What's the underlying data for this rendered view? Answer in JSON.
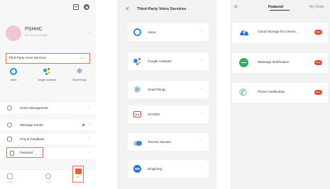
{
  "screen1": {
    "username": "PSHHC",
    "user_hint": "Set Personal Details",
    "third_party": {
      "label": "Third-Party Voice Services",
      "more": "More"
    },
    "voice_services": [
      {
        "name": "Alexa",
        "icon": "alexa-ring-icon"
      },
      {
        "name": "Google Assistant",
        "icon": "google-assistant-icon"
      },
      {
        "name": "SmartThings",
        "icon": "smartthings-star-icon"
      }
    ],
    "menu": [
      {
        "label": "Home Management",
        "icon": "home-icon"
      },
      {
        "label": "Message Center",
        "icon": "message-icon"
      },
      {
        "label": "FAQ & Feedback",
        "icon": "faq-icon"
      },
      {
        "label": "Featured",
        "icon": "featured-icon"
      }
    ],
    "tabs": [
      {
        "label": "Home",
        "icon": "home-tab-icon"
      },
      {
        "label": "Smart",
        "icon": "smart-tab-icon"
      },
      {
        "label": "Me",
        "icon": "me-tab-icon"
      }
    ]
  },
  "screen2": {
    "back": "<",
    "title": "Third-Party Voice Services",
    "services": [
      "Alexa",
      "Google Assistant",
      "SmartThings",
      "XIAODU",
      "Tencent Xiaowei",
      "DingDong"
    ]
  },
  "screen3": {
    "back": "<",
    "tab_active": "Featured",
    "tab_other": "My Order",
    "items": [
      {
        "label": "Cloud Storage for Camer...",
        "icon": "cloud-icon",
        "badge": "Open"
      },
      {
        "label": "Message Notification",
        "icon": "message-bubble-icon",
        "badge": "Open"
      },
      {
        "label": "Phone Notification",
        "icon": "phone-icon",
        "badge": "Open"
      }
    ]
  },
  "colors": {
    "highlight": "#e8704f",
    "alexa": "#2b8fe0",
    "accent_red": "#e2492f",
    "green": "#3ca868",
    "cloud_blue": "#1e73d8"
  }
}
